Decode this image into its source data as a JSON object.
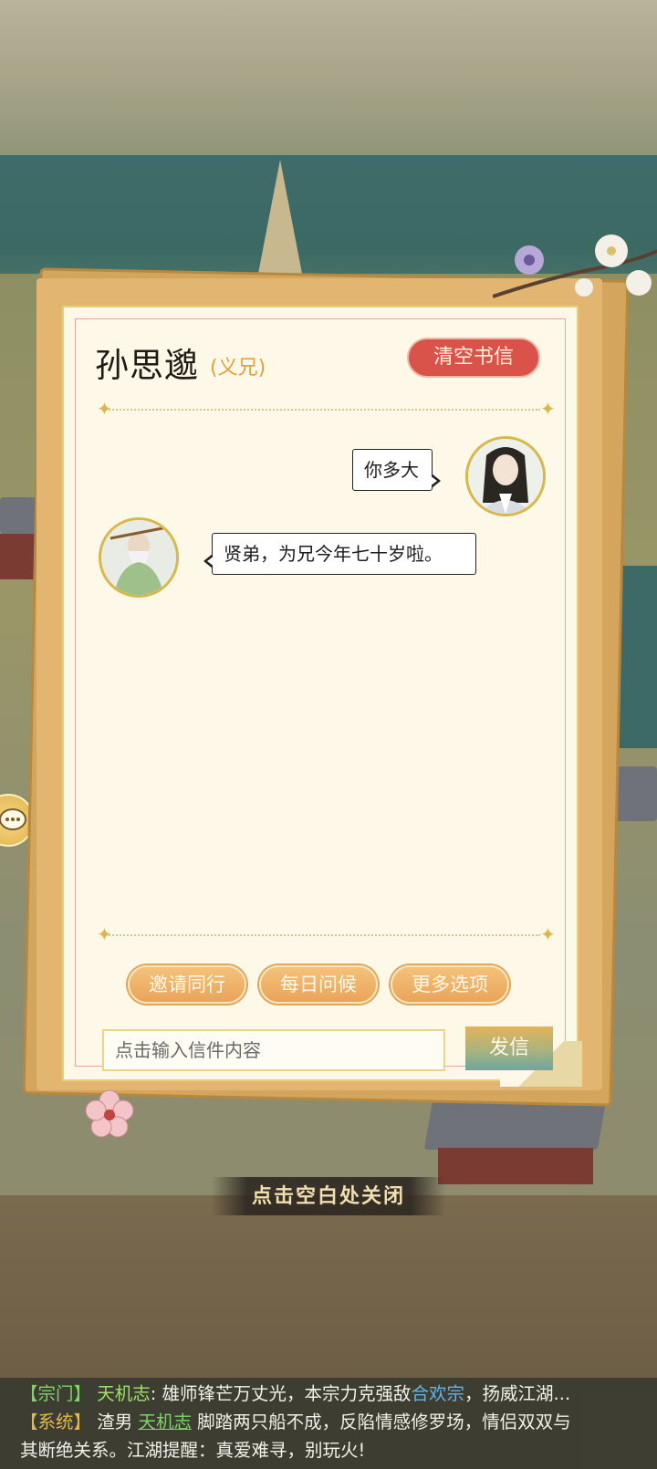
{
  "letter": {
    "name": "孙思邈",
    "relation": "(义兄)",
    "clear_label": "清空书信",
    "messages": [
      {
        "from": "self",
        "text": "你多大"
      },
      {
        "from": "contact",
        "text": "贤弟，为兄今年七十岁啦。"
      }
    ],
    "options": [
      "邀请同行",
      "每日问候",
      "更多选项"
    ],
    "input_placeholder": "点击输入信件内容",
    "send_label": "发信"
  },
  "close_hint": "点击空白处关闭",
  "log": {
    "line1": {
      "tag": "【宗门】",
      "speaker": "天机志",
      "colon": ":",
      "text_a": "雄师锋芒万丈光，本宗力克强敌",
      "link": "合欢宗",
      "text_b": "，扬威江湖..."
    },
    "line2": {
      "tag": "【系统】",
      "text_a": "渣男",
      "link": "天机志",
      "text_b": "脚踏两只船不成，反陷情感修罗场，情侣双双与"
    },
    "line3": {
      "text": "其断绝关系。江湖提醒：真爱难寻，别玩火!"
    }
  },
  "colors": {
    "clear_button": "#d9534a",
    "option_button": "#e9a45a",
    "relation_text": "#e0a23a",
    "paper": "#fdf8e8"
  },
  "icons": [
    "sparkle-icon",
    "plum-blossom-icon",
    "chat-bubble-icon"
  ]
}
